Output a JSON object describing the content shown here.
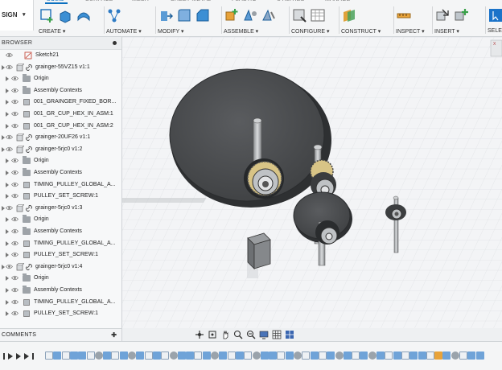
{
  "toolbar": {
    "workspace_label": "SIGN",
    "tabs": [
      {
        "label": "SOLID",
        "active": true
      },
      {
        "label": "SURFACE",
        "active": false
      },
      {
        "label": "MESH",
        "active": false
      },
      {
        "label": "SHEET METAL",
        "active": false
      },
      {
        "label": "PLASTIC",
        "active": false
      },
      {
        "label": "UTILITIES",
        "active": false
      },
      {
        "label": "MANAGE",
        "active": false
      }
    ],
    "groups": [
      {
        "label": "CREATE ▾",
        "icons": [
          "sketch-plus-icon",
          "extrude-icon",
          "revolve-icon"
        ]
      },
      {
        "label": "AUTOMATE ▾",
        "icons": [
          "automate-icon"
        ]
      },
      {
        "label": "MODIFY ▾",
        "icons": [
          "press-pull-icon",
          "fillet-icon",
          "chamfer-icon"
        ]
      },
      {
        "label": "ASSEMBLE ▾",
        "icons": [
          "new-component-icon",
          "joint-icon",
          "as-built-joint-icon"
        ]
      },
      {
        "label": "CONFIGURE ▾",
        "icons": [
          "configure-icon",
          "table-icon"
        ]
      },
      {
        "label": "CONSTRUCT ▾",
        "icons": [
          "offset-plane-icon"
        ]
      },
      {
        "label": "INSPECT ▾",
        "icons": [
          "measure-icon"
        ]
      },
      {
        "label": "INSERT ▾",
        "icons": [
          "insert-derive-icon",
          "insert-mesh-icon"
        ]
      },
      {
        "label": "SELEC",
        "icons": [
          "select-icon"
        ]
      }
    ]
  },
  "browser": {
    "title": "BROWSER",
    "items": [
      {
        "label": "Sketch21",
        "kind": "sketch",
        "indent": 0
      },
      {
        "label": "grainger-55VZ15 v1:1",
        "kind": "component",
        "indent": 0
      },
      {
        "label": "Origin",
        "kind": "folder",
        "indent": 1
      },
      {
        "label": "Assembly Contexts",
        "kind": "folder-plain",
        "indent": 1
      },
      {
        "label": "001_GRAINGER_FIXED_BOR...",
        "kind": "body",
        "indent": 1
      },
      {
        "label": "001_GR_CUP_HEX_IN_ASM:1",
        "kind": "body",
        "indent": 1
      },
      {
        "label": "001_GR_CUP_HEX_IN_ASM:2",
        "kind": "body",
        "indent": 1
      },
      {
        "label": "grainger-20UF26 v1:1",
        "kind": "component",
        "indent": 0
      },
      {
        "label": "grainger-5rjc0 v1:2",
        "kind": "component",
        "indent": 0
      },
      {
        "label": "Origin",
        "kind": "folder",
        "indent": 1
      },
      {
        "label": "Assembly Contexts",
        "kind": "folder-plain",
        "indent": 1
      },
      {
        "label": "TIMING_PULLEY_GLOBAL_A...",
        "kind": "body",
        "indent": 1
      },
      {
        "label": "PULLEY_SET_SCREW:1",
        "kind": "body",
        "indent": 1
      },
      {
        "label": "grainger-5rjc0 v1:3",
        "kind": "component",
        "indent": 0
      },
      {
        "label": "Origin",
        "kind": "folder",
        "indent": 1
      },
      {
        "label": "Assembly Contexts",
        "kind": "folder-plain",
        "indent": 1
      },
      {
        "label": "TIMING_PULLEY_GLOBAL_A...",
        "kind": "body",
        "indent": 1
      },
      {
        "label": "PULLEY_SET_SCREW:1",
        "kind": "body",
        "indent": 1
      },
      {
        "label": "grainger-5rjc0 v1:4",
        "kind": "component",
        "indent": 0
      },
      {
        "label": "Origin",
        "kind": "folder",
        "indent": 1
      },
      {
        "label": "Assembly Contexts",
        "kind": "folder-plain",
        "indent": 1
      },
      {
        "label": "TIMING_PULLEY_GLOBAL_A...",
        "kind": "body",
        "indent": 1
      },
      {
        "label": "PULLEY_SET_SCREW:1",
        "kind": "body",
        "indent": 1
      }
    ]
  },
  "comments": {
    "title": "COMMENTS"
  },
  "timeline": {
    "feature_icons": [
      "sketch",
      "body",
      "sketch",
      "body",
      "body",
      "sketch",
      "joint",
      "body",
      "sketch",
      "body",
      "joint",
      "body",
      "sketch",
      "body",
      "sketch",
      "joint",
      "body",
      "body",
      "sketch",
      "body",
      "joint",
      "body",
      "sketch",
      "body",
      "sketch",
      "joint",
      "body",
      "body",
      "sketch",
      "body",
      "joint",
      "sketch",
      "body",
      "sketch",
      "body",
      "joint",
      "body",
      "sketch",
      "body",
      "joint",
      "body",
      "sketch",
      "body",
      "sketch",
      "body",
      "body",
      "sketch",
      "orange",
      "body",
      "joint",
      "sketch",
      "body",
      "body"
    ]
  },
  "colors": {
    "accent": "#0a6fbf",
    "disk": "#4b4d4f",
    "grid": "#dfe2e5"
  }
}
